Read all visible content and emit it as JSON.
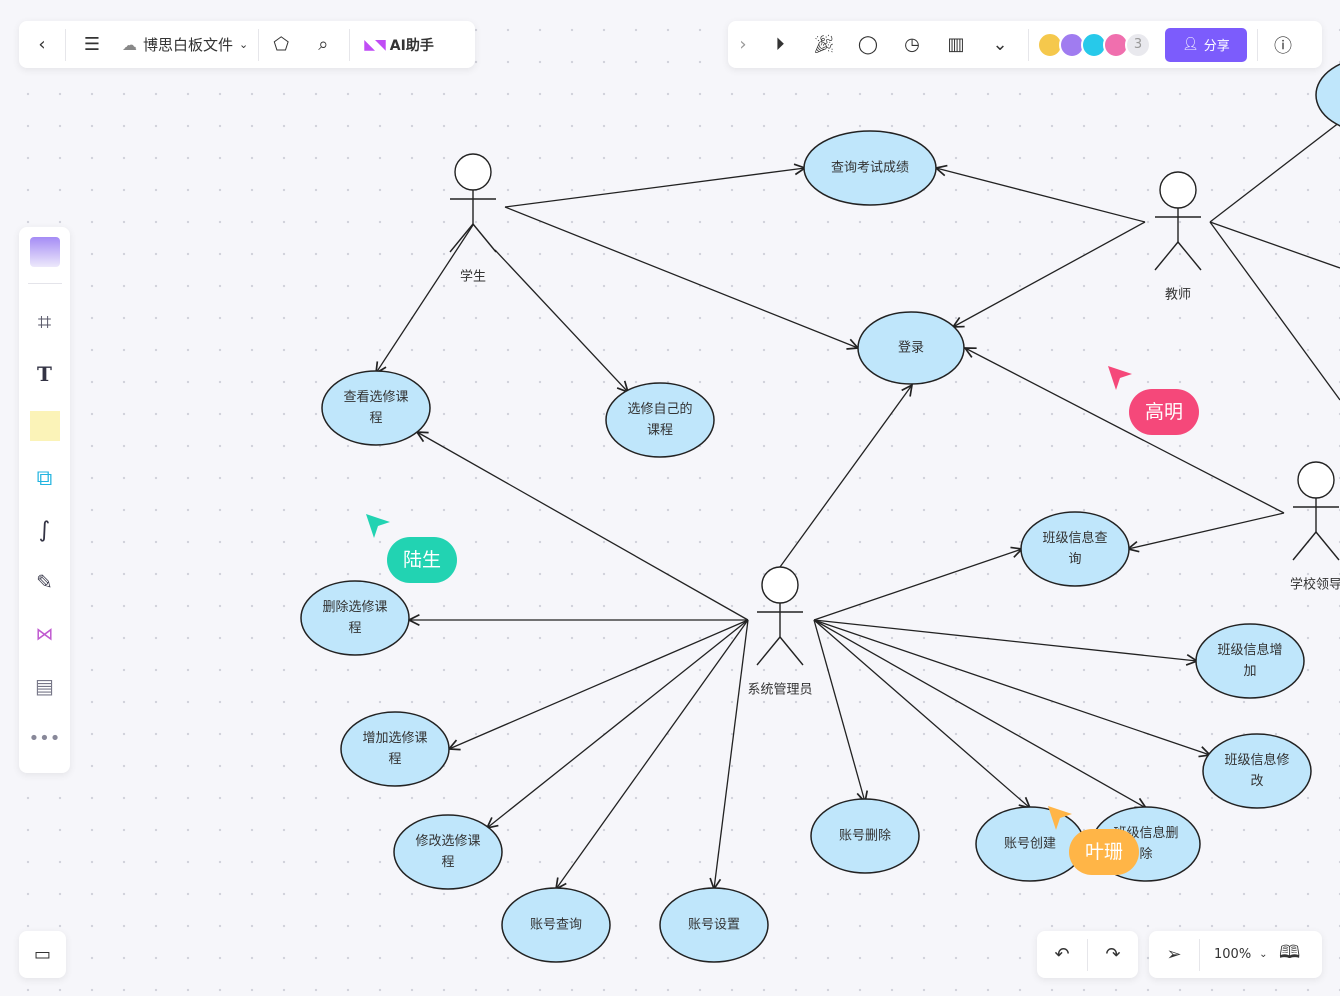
{
  "topbar_left": {
    "file_name": "博思白板文件",
    "ai_label": "AI助手",
    "icons": [
      "back-icon",
      "menu-icon",
      "cloud-sync-icon",
      "chevron-down-icon",
      "tag-icon",
      "search-icon",
      "ai-logo-icon"
    ]
  },
  "topbar_right": {
    "collaborator_count": "3",
    "share_label": "分享",
    "icons": [
      "expand-icon",
      "play-icon",
      "celebrate-icon",
      "comment-icon",
      "timer-icon",
      "vote-icon",
      "more-icon",
      "help-icon"
    ]
  },
  "colors": {
    "accent": "#7c5cfc",
    "node_fill": "#bfe6fb",
    "lu_sheng": "#22d3b2",
    "gao_ming": "#f5487a",
    "ye_shan": "#ffb547"
  },
  "diagram": {
    "actors": {
      "student": "学生",
      "teacher": "教师",
      "admin": "系统管理员",
      "leader": "学校领导"
    },
    "nodes": {
      "exam": [
        "查询考试成绩"
      ],
      "login": [
        "登录"
      ],
      "view": [
        "查看选修课",
        "程"
      ],
      "select": [
        "选修自己的",
        "课程"
      ],
      "cq": [
        "班级信息查",
        "询"
      ],
      "ca": [
        "班级信息增",
        "加"
      ],
      "cm": [
        "班级信息修",
        "改"
      ],
      "del": [
        "删除选修课",
        "程"
      ],
      "add": [
        "增加选修课",
        "程"
      ],
      "mod": [
        "修改选修课",
        "程"
      ],
      "aq": [
        "账号查询"
      ],
      "as": [
        "账号设置"
      ],
      "ad": [
        "账号删除"
      ],
      "ac": [
        "账号创建"
      ],
      "cd": [
        "班级信息删",
        "除"
      ]
    }
  },
  "cursors": {
    "lu": "陆生",
    "gao": "高明",
    "ye": "叶珊"
  },
  "bottom": {
    "zoom": "100%"
  }
}
